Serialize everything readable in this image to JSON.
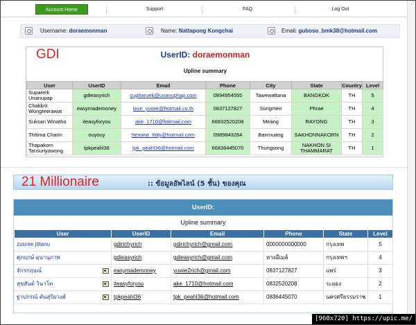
{
  "nav": {
    "items": [
      "Account Home",
      "Support",
      "FAQ",
      "Log Out"
    ]
  },
  "info_bar": {
    "username_label": "Username:",
    "username_value": "doraemonman",
    "name_label": "Name:",
    "name_value": "Nattapong Kongchai",
    "email_label": "Email:",
    "email_value": "guboso_bmk38@hotmail.com"
  },
  "gdi": {
    "annotation": "GDI",
    "userid_label": "UserID:",
    "userid_value": "doraemonman",
    "summary_title": "Upline summary",
    "columns": [
      "User",
      "UserID",
      "Email",
      "Phone",
      "City",
      "State",
      "Country",
      "Level"
    ],
    "rows": [
      {
        "user": "Suparerk Unanupap",
        "userid": "gdieasyrich",
        "email": "supharuek@unanuphap.com",
        "phone": "0894954555",
        "city": "Tawewattana",
        "state": "BANGKOK",
        "country": "TH",
        "level": "5"
      },
      {
        "user": "Chakkrit Wongteerawat",
        "userid": "easymademoney",
        "email": "love_yuwie@hotmail.co.th",
        "phone": "0837127827",
        "city": "Sungmen",
        "state": "Phrae",
        "country": "TH",
        "level": "4"
      },
      {
        "user": "Suksan Winatho",
        "userid": "iteasyforyou",
        "email": "ake_1710@hotmail.com",
        "phone": "66832520208",
        "city": "Meang",
        "state": "RAYONG",
        "country": "TH",
        "level": "3"
      },
      {
        "user": "Thitima Charin",
        "userid": "ouyouy",
        "email": "heroine_thity@hotmail.com",
        "phone": "0989843264",
        "city": "Banmuang",
        "state": "SAKHONNAKORN",
        "country": "TH",
        "level": "2"
      },
      {
        "user": "Thapakorn Tansuriyawong",
        "userid": "tpkpeahl36",
        "email": "tpk_peahl36@hotmail.com",
        "phone": "66836445070",
        "city": "Thungsong",
        "state": "NAKHON SI THAMMARAT",
        "country": "TH",
        "level": "1"
      }
    ]
  },
  "mlm": {
    "annotation": "21 Millionaire",
    "banner_title": ":: ข้อมูลอัพไลน์ (5 ชั้น) ของคุณ",
    "userid_label": "UserID:",
    "summary_title": "Upline summary",
    "columns": [
      "User",
      "UserID",
      "Email",
      "Phone",
      "State",
      "Level"
    ],
    "rows": [
      {
        "user": "zuuree jittanu",
        "card": false,
        "userid": "gdirichyrich",
        "email": "gdirichyrich@gmail.com",
        "phone": "0000000000000",
        "state": "กรุงเทพ",
        "level": "5"
      },
      {
        "user": "ศุภฤกษ์ อุนานุภาพ",
        "card": false,
        "userid": "gdieasyrich",
        "email": "gdieasyrich@gmail.com",
        "phone": "หางอีเมล์",
        "state": "กรุงเทพฯ",
        "level": "4"
      },
      {
        "user": "จักรกฤษณ์",
        "card": true,
        "userid": "easymademoney",
        "email": "yuwie2rich@gmail.com",
        "phone": "0837127827",
        "state": "แพร่",
        "level": "3"
      },
      {
        "user": "สุขสันต์ วินาโท",
        "card": true,
        "userid": "iteasyforyou",
        "email": "ake_1710@hotmail.com",
        "phone": "0832520208",
        "state": "ระยอง",
        "level": "2"
      },
      {
        "user": "ฐาปกรณ์ ตันสุริยวงศ์",
        "card": true,
        "userid": "tpkpeahl36",
        "email": "tpk_peahl36@hotmail.com",
        "phone": "0836445070",
        "state": "นครศรีธรรมราช",
        "level": "1"
      }
    ]
  },
  "watermark": "[960x720] https://upic.me/"
}
